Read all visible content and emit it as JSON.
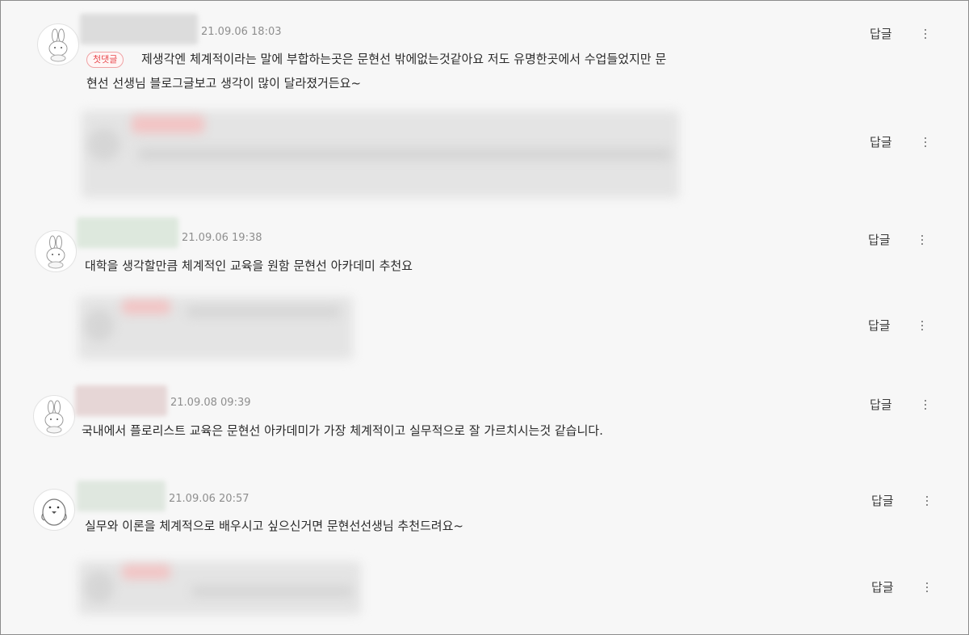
{
  "comments": [
    {
      "date": "21.09.06 18:03",
      "badge": "첫댓글",
      "text_line1": "제생각엔 체계적이라는 말에 부합하는곳은 문현선 밖에없는것같아요 저도 유명한곳에서 수업들었지만 문",
      "text_line2": "현선 선생님 블로그글보고 생각이 많이 달라졌거든요~",
      "reply_label": "답글"
    },
    {
      "date": "21.09.06 19:38",
      "text_line1": "대학을 생각할만큼 체계적인 교육을 원함 문현선 아카데미 추천요",
      "reply_label": "답글"
    },
    {
      "date": "21.09.08 09:39",
      "text_line1": "국내에서 플로리스트 교육은 문현선 아카데미가 가장 체계적이고 실무적으로 잘 가르치시는것 같습니다.",
      "reply_label": "답글"
    },
    {
      "date": "21.09.06 20:57",
      "text_line1": "실무와 이론을 체계적으로 배우시고 싶으신거면 문현선선생님 추천드려요~",
      "reply_label": "답글"
    }
  ],
  "replies": [
    {
      "reply_label": "답글"
    },
    {
      "reply_label": "답글"
    },
    {
      "reply_label": "답글"
    }
  ],
  "icons": {
    "more": "more-vertical-icon",
    "avatar_rabbit": "rabbit-avatar-icon",
    "avatar_penguin": "penguin-avatar-icon"
  },
  "colors": {
    "badge": "#e8484d",
    "background": "#f7f7f7"
  }
}
